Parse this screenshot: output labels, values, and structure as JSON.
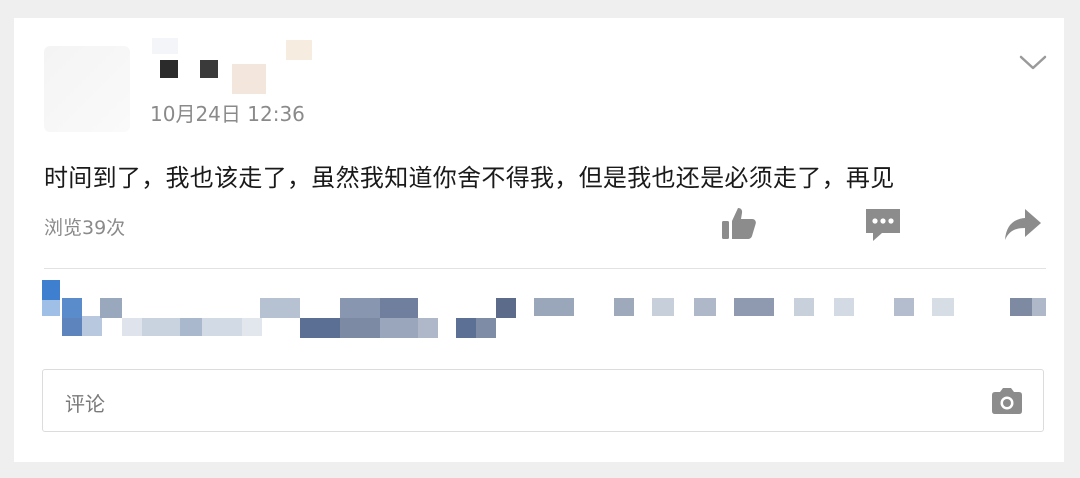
{
  "post": {
    "timestamp": "10月24日 12:36",
    "text": "时间到了，我也该走了，虽然我知道你舍不得我，但是我也还是必须走了，再见",
    "views": "浏览39次"
  },
  "actions": {
    "like_icon": "thumbs-up-icon",
    "comment_icon": "comment-bubble-icon",
    "share_icon": "share-arrow-icon",
    "menu_icon": "chevron-down-icon"
  },
  "comment_input": {
    "placeholder": "评论",
    "camera_icon": "camera-icon"
  },
  "colors": {
    "icon_gray": "#8c8c8c",
    "text_primary": "#1a1a1a",
    "text_secondary": "#8a8a8a",
    "mosaic_blue": "#3f7fd0"
  }
}
